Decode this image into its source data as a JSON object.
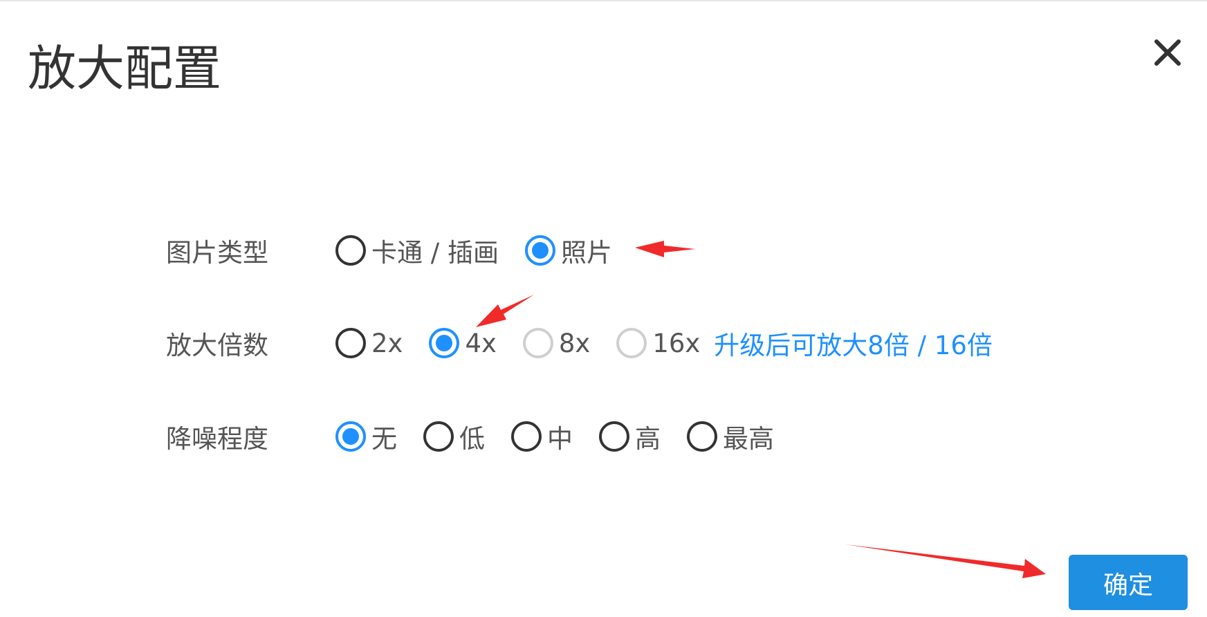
{
  "dialog": {
    "title": "放大配置",
    "close_icon": "close-icon",
    "confirm_label": "确定"
  },
  "image_type": {
    "label": "图片类型",
    "options": [
      {
        "label": "卡通 / 插画",
        "checked": false,
        "disabled": false
      },
      {
        "label": "照片",
        "checked": true,
        "disabled": false
      }
    ]
  },
  "scale": {
    "label": "放大倍数",
    "options": [
      {
        "label": "2x",
        "checked": false,
        "disabled": false
      },
      {
        "label": "4x",
        "checked": true,
        "disabled": false
      },
      {
        "label": "8x",
        "checked": false,
        "disabled": true
      },
      {
        "label": "16x",
        "checked": false,
        "disabled": true
      }
    ],
    "upgrade_link": "升级后可放大8倍 / 16倍"
  },
  "denoise": {
    "label": "降噪程度",
    "options": [
      {
        "label": "无",
        "checked": true,
        "disabled": false
      },
      {
        "label": "低",
        "checked": false,
        "disabled": false
      },
      {
        "label": "中",
        "checked": false,
        "disabled": false
      },
      {
        "label": "高",
        "checked": false,
        "disabled": false
      },
      {
        "label": "最高",
        "checked": false,
        "disabled": false
      }
    ]
  },
  "colors": {
    "accent": "#1e90ff",
    "annotation_arrow": "#f02a2a"
  }
}
